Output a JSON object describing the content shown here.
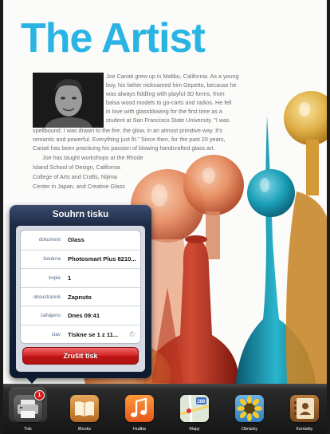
{
  "document": {
    "title": "The Artist",
    "lines": [
      "Joe Cariati grew up in Malibu, California. As a young",
      "boy, his father nicknamed him Gepetto, because he",
      "was always fiddling with playful 3D forms, from",
      "balsa wood models to go-carts and radios. He fell",
      "in love with glassblowing for the first time as a",
      "student at San Francisco State University. \"I was",
      "spellbound. I was drawn to the fire, the glow, in an almost primitive way. It's",
      "romantic and powerful. Everything just fit.\" Since then, for the past 20 years,",
      "Cariati has been practicing his passion of blowing handcrafted glass art.",
      "Joe has taught workshops at the Rhode",
      "Island School of Design, California",
      "College of Arts and Crafts, Nijima",
      "Center in Japan, and Creative Glass"
    ]
  },
  "print_summary": {
    "title": "Souhrn tisku",
    "rows": [
      {
        "key": "dokument",
        "value": "Glass"
      },
      {
        "key": "tiskárna",
        "value": "Photosmart Plus 8210..."
      },
      {
        "key": "kopie",
        "value": "1"
      },
      {
        "key": "oboustranně",
        "value": "Zapnuto"
      },
      {
        "key": "zahájeno",
        "value": "Dnes 09:41"
      },
      {
        "key": "stav",
        "value": "Tiskne se 1 z 11..."
      }
    ],
    "cancel_label": "Zrušit tisk"
  },
  "dock": {
    "apps": [
      {
        "label": "Tisk",
        "icon": "printer-icon"
      },
      {
        "label": "iBooks",
        "icon": "ibooks-icon"
      },
      {
        "label": "Hudba",
        "icon": "music-icon"
      },
      {
        "label": "Mapy",
        "icon": "maps-icon"
      },
      {
        "label": "Obrázky",
        "icon": "photos-icon"
      },
      {
        "label": "Kontakty",
        "icon": "contacts-icon"
      }
    ],
    "badge_count": "1",
    "map_sign": "280"
  },
  "colors": {
    "title_blue": "#29b4e3",
    "popover_navy": "#0e1a30",
    "cancel_red": "#d52525",
    "badge_red": "#d61818"
  }
}
